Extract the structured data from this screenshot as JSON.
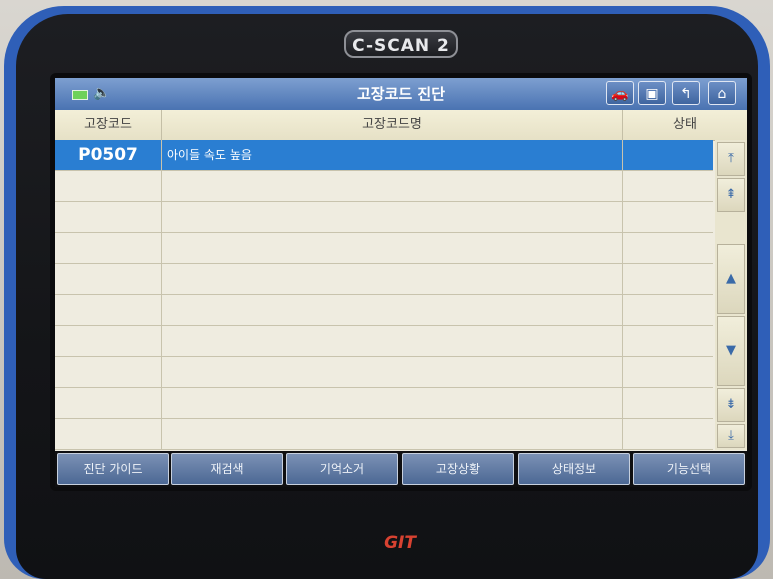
{
  "device": {
    "brand_label": "C-SCAN 2",
    "bottom_logo": "GIT"
  },
  "titlebar": {
    "title": "고장코드 진단",
    "battery_icon": "battery-icon",
    "speaker_icon": "speaker-icon",
    "buttons": [
      {
        "name": "car-icon",
        "glyph": "🚗"
      },
      {
        "name": "screen-icon",
        "glyph": "▣"
      },
      {
        "name": "back-icon",
        "glyph": "↰"
      },
      {
        "name": "home-icon",
        "glyph": "⌂"
      }
    ]
  },
  "table": {
    "columns": [
      "고장코드",
      "고장코드명",
      "상태"
    ],
    "rows": [
      {
        "code": "P0507",
        "description": "아이들 속도 높음",
        "status": "",
        "selected": true
      }
    ]
  },
  "scroll_buttons": [
    {
      "name": "scroll-top-icon",
      "glyph": "⤒"
    },
    {
      "name": "scroll-page-up-icon",
      "glyph": "⇞"
    },
    {
      "name": "scroll-up-icon",
      "glyph": "▲"
    },
    {
      "name": "scroll-down-icon",
      "glyph": "▼"
    },
    {
      "name": "scroll-page-down-icon",
      "glyph": "⇟"
    },
    {
      "name": "scroll-bottom-icon",
      "glyph": "⤓"
    }
  ],
  "bottom_buttons": [
    "진단 가이드",
    "재검색",
    "기억소거",
    "고장상황",
    "상태정보",
    "기능선택"
  ]
}
